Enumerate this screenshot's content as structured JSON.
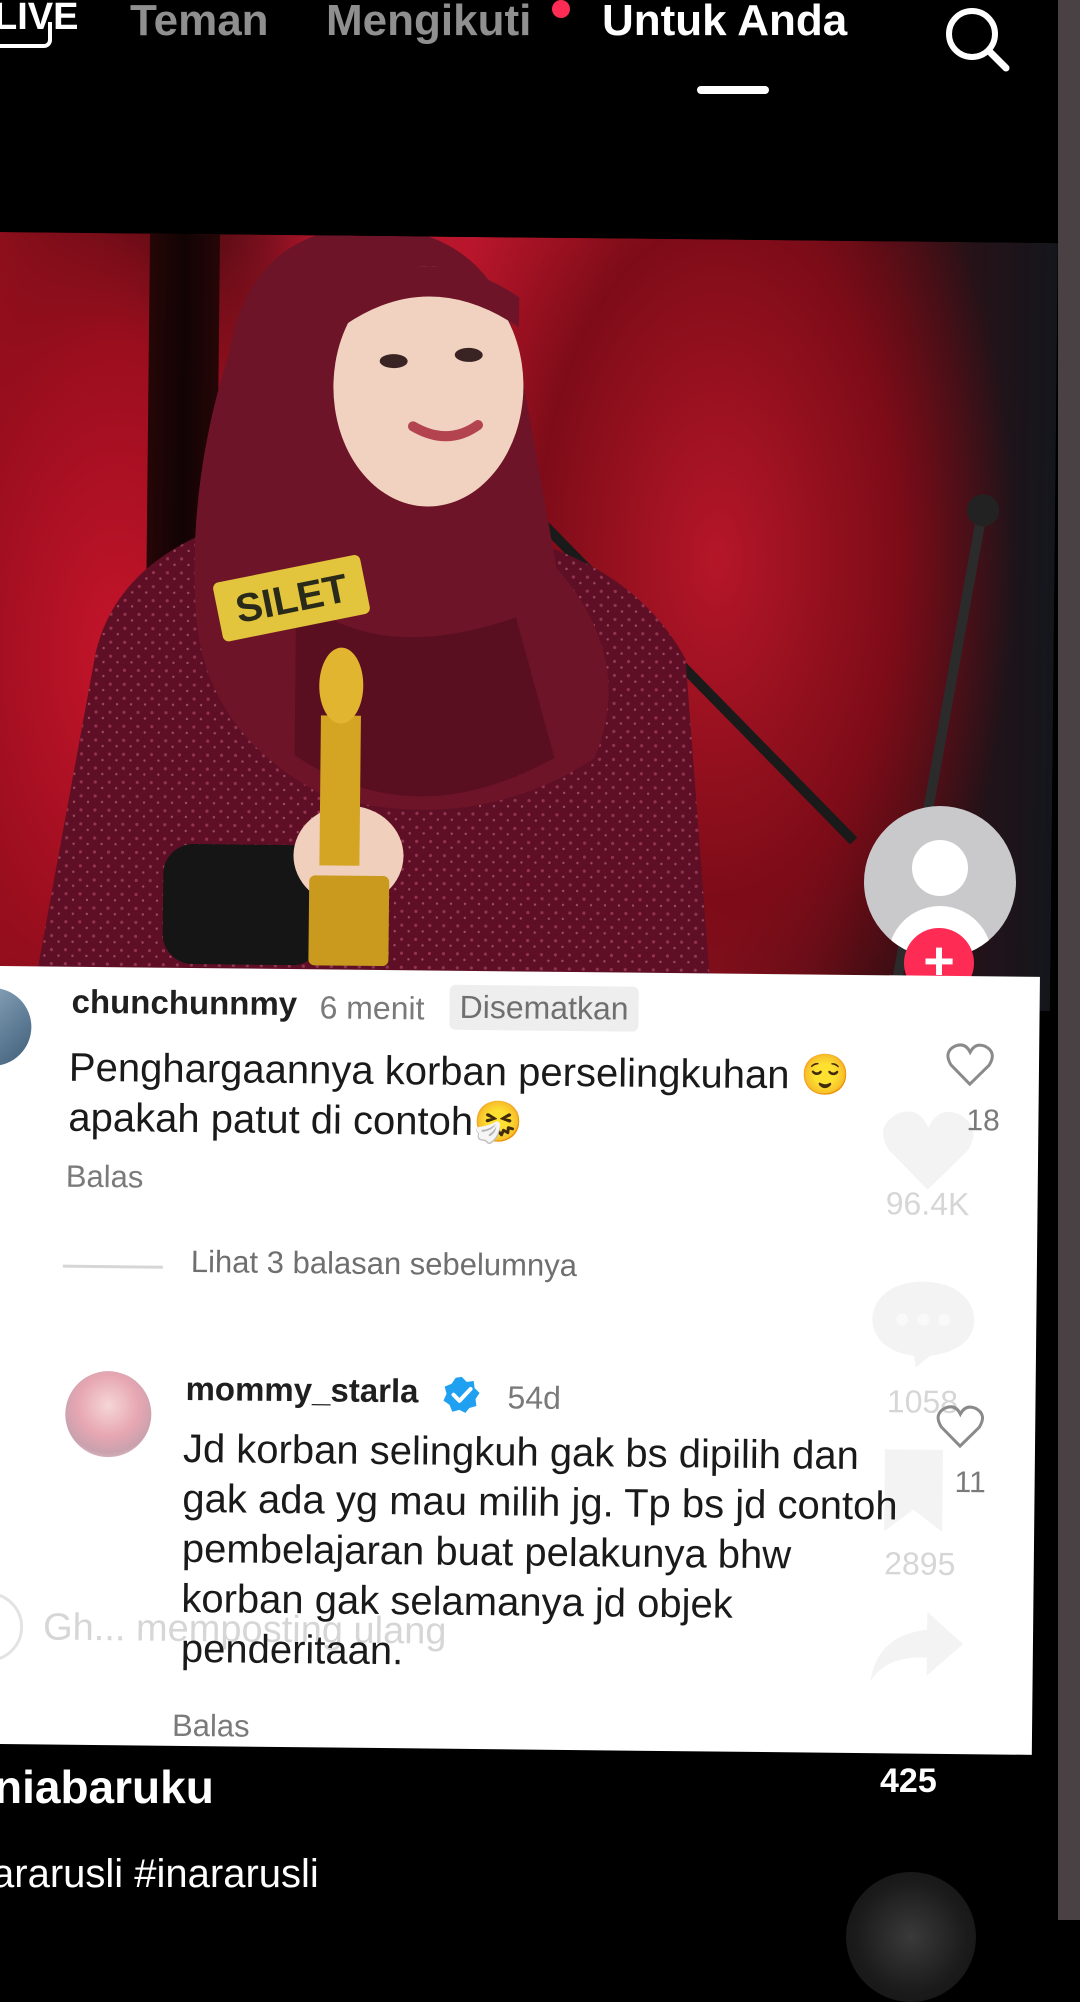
{
  "nav": {
    "tabs": [
      {
        "label": "LIVE",
        "active": false
      },
      {
        "label": "Teman",
        "active": false
      },
      {
        "label": "Mengikuti",
        "active": false,
        "has_dot": true
      },
      {
        "label": "Untuk Anda",
        "active": true
      }
    ],
    "search_icon": "search-icon"
  },
  "video": {
    "photo_text": "SILET",
    "flag_icon": "flag-icon",
    "author": "niabaruku",
    "caption": "ararusli #inararusli",
    "share_count": "425"
  },
  "comments": [
    {
      "username": "chunchunnmy",
      "time": "6 menit",
      "pinned_label": "Disematkan",
      "text": "Penghargaannya korban perselingkuhan 😌 apakah patut di contoh🤧",
      "reply_label": "Balas",
      "like_count": "18"
    },
    {
      "username": "mommy_starla",
      "verified": true,
      "time": "54d",
      "text": "Jd korban selingkuh gak bs dipilih dan gak ada yg mau milih jg. Tp bs jd contoh pembelajaran buat pelakunya bhw korban gak selamanya jd objek penderitaan.",
      "reply_label": "Balas",
      "like_count": "11"
    }
  ],
  "view_replies": "Lihat 3 balasan sebelumnya",
  "overlay": {
    "likes": "96.4K",
    "comments": "1058",
    "saves": "2895",
    "repost": "Gh... memposting ulang"
  },
  "colors": {
    "accent": "#fe2c55",
    "verified": "#20a0f0"
  }
}
